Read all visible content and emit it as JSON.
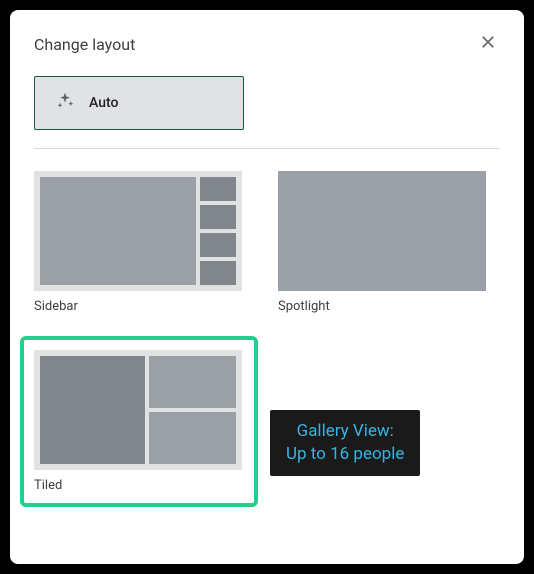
{
  "header": {
    "title": "Change layout"
  },
  "auto": {
    "label": "Auto"
  },
  "options": {
    "sidebar": {
      "label": "Sidebar"
    },
    "spotlight": {
      "label": "Spotlight"
    },
    "tiled": {
      "label": "Tiled"
    }
  },
  "tooltip": {
    "line1": "Gallery View:",
    "line2": "Up to 16 people"
  }
}
